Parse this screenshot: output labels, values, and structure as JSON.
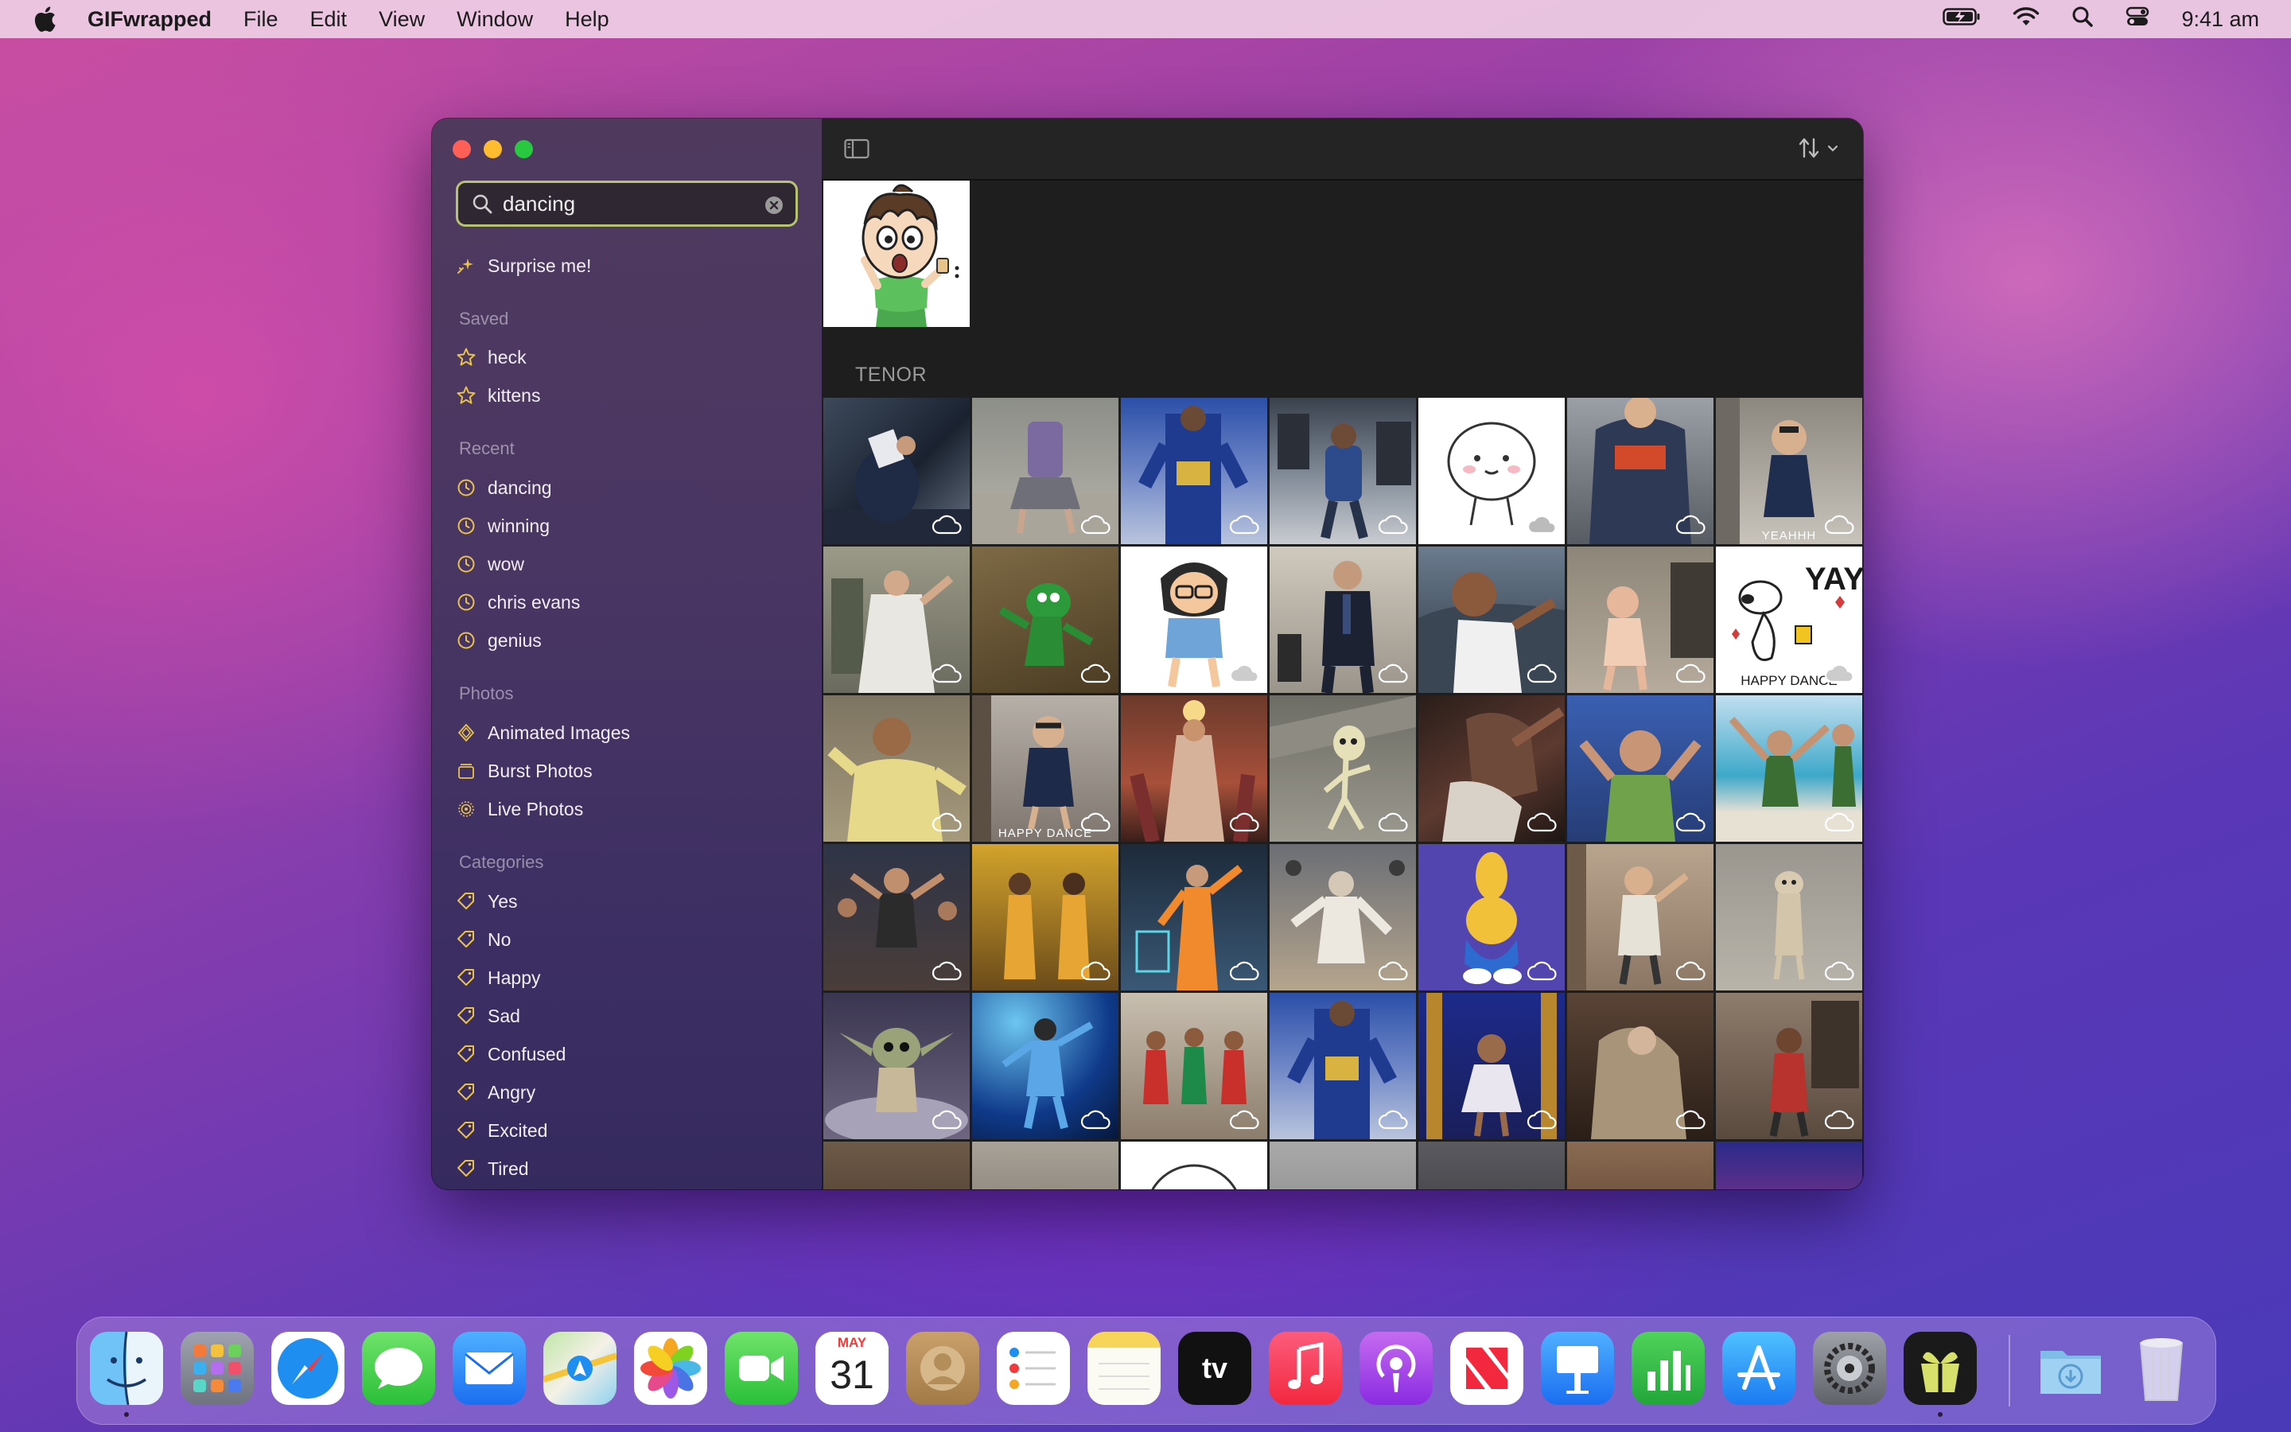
{
  "menubar": {
    "app_name": "GIFwrapped",
    "menus": [
      "File",
      "Edit",
      "View",
      "Window",
      "Help"
    ],
    "clock": "9:41 am"
  },
  "sidebar": {
    "search_value": "dancing",
    "surprise": "Surprise me!",
    "saved_header": "Saved",
    "saved": [
      "heck",
      "kittens"
    ],
    "recent_header": "Recent",
    "recent": [
      "dancing",
      "winning",
      "wow",
      "chris evans",
      "genius"
    ],
    "photos_header": "Photos",
    "photos": [
      "Animated Images",
      "Burst Photos",
      "Live Photos"
    ],
    "categories_header": "Categories",
    "categories": [
      "Yes",
      "No",
      "Happy",
      "Sad",
      "Confused",
      "Angry",
      "Excited",
      "Tired"
    ]
  },
  "main": {
    "section_label": "TENOR",
    "captions": {
      "r0c6": "YEAHHH",
      "r1c6_top": "YAY",
      "r1c6_bottom": "HAPPY DANCE",
      "r2c1": "HAPPY DANCE"
    }
  },
  "dock": {
    "calendar_month": "MAY",
    "calendar_day": "31",
    "tv_label": "tv"
  },
  "colors": {
    "accent_search_border": "#b7c46f",
    "window_bg": "#1e1e1e"
  }
}
